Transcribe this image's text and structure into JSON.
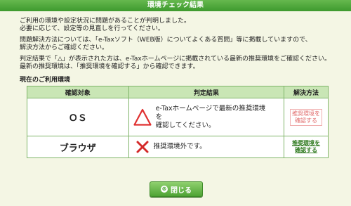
{
  "window": {
    "title": "環境チェック結果"
  },
  "messages": {
    "line1": "ご利用の環境や設定状況に問題があることが判明しました。",
    "line2": "必要に応じて、設定等の見直しを行ってください。",
    "line3": "問題解決方法については、「e-Taxソフト（WEB版）についてよくある質問」等に掲載していますので、",
    "line4": "解決方法からご確認ください。",
    "line5": "判定結果で「△」が表示された方は、e-Taxホームページに掲載されている最新の推奨環境をご確認ください。",
    "line6": "最新の推奨環境は、「推奨環境を確認する」から確認できます。"
  },
  "section": {
    "heading": "現在のご利用環境"
  },
  "table": {
    "headers": [
      "確認対象",
      "判定結果",
      "解決方法"
    ],
    "rows": [
      {
        "target": "ＯＳ",
        "result_icon": "warning-triangle-icon",
        "result_text": "e-Taxホームページで最新の推奨環境\nを\n確認してください。",
        "solution": "推奨環境を\n確認する",
        "solution_enabled": false
      },
      {
        "target": "ブラウザ",
        "result_icon": "cross-icon",
        "result_text": "推奨環境外です。",
        "solution": "推奨環境を\n確認する",
        "solution_enabled": true
      }
    ]
  },
  "footer": {
    "close_label": "閉じる",
    "close_glyph": "⊗"
  },
  "colors": {
    "accent": "#4ea334",
    "triangle": "#e03030",
    "cross": "#d42a2a"
  }
}
